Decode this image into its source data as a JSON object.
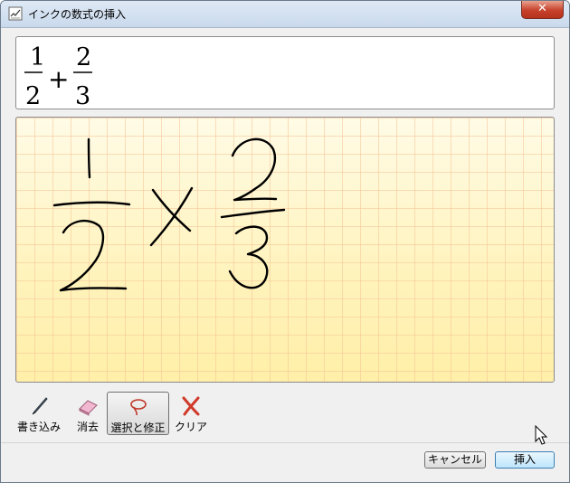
{
  "window": {
    "title": "インクの数式の挿入",
    "close_label": "✕"
  },
  "preview": {
    "term1": {
      "numerator": "1",
      "denominator": "2"
    },
    "operator": "+",
    "term2": {
      "numerator": "2",
      "denominator": "3"
    }
  },
  "toolbar": {
    "items": [
      {
        "label": "書き込み",
        "icon": "pen-icon"
      },
      {
        "label": "消去",
        "icon": "eraser-icon"
      },
      {
        "label": "選択と修正",
        "icon": "lasso-icon",
        "selected": true
      },
      {
        "label": "クリア",
        "icon": "clear-x-icon"
      }
    ]
  },
  "buttons": {
    "cancel_label": "キャンセル",
    "insert_label": "挿入"
  },
  "colors": {
    "ink": "#000000",
    "grid_background": "#fff6c8",
    "grid_line": "#f6c496",
    "clear_icon": "#d03a2a",
    "lasso_icon": "#c0392b"
  }
}
